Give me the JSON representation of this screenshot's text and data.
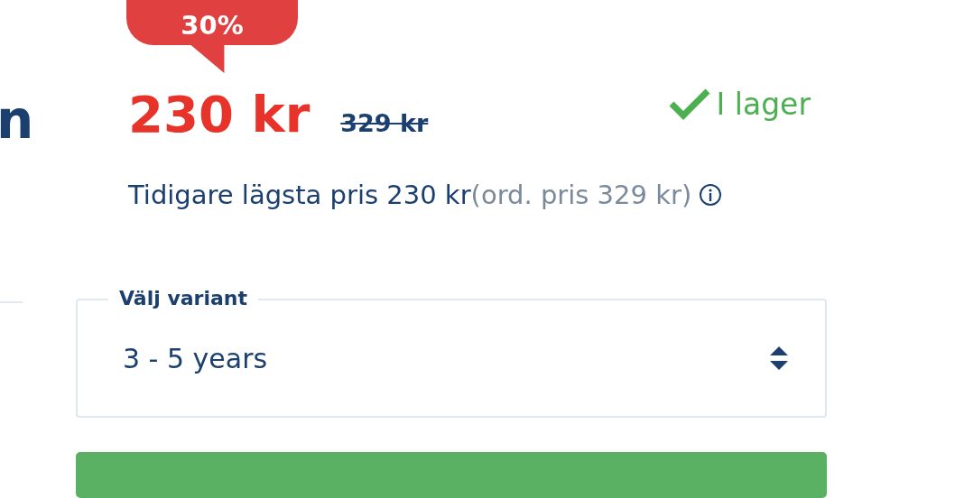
{
  "title_fragment": "n",
  "discount_badge": "30%",
  "price": "230 kr",
  "old_price": "329 kr",
  "stock": {
    "label": "I lager",
    "in_stock": true
  },
  "lowest_price": {
    "text": "Tidigare lägsta pris 230 kr",
    "ordinary": "(ord. pris 329 kr)"
  },
  "variant": {
    "label": "Välj variant",
    "value": "3 - 5 years"
  }
}
